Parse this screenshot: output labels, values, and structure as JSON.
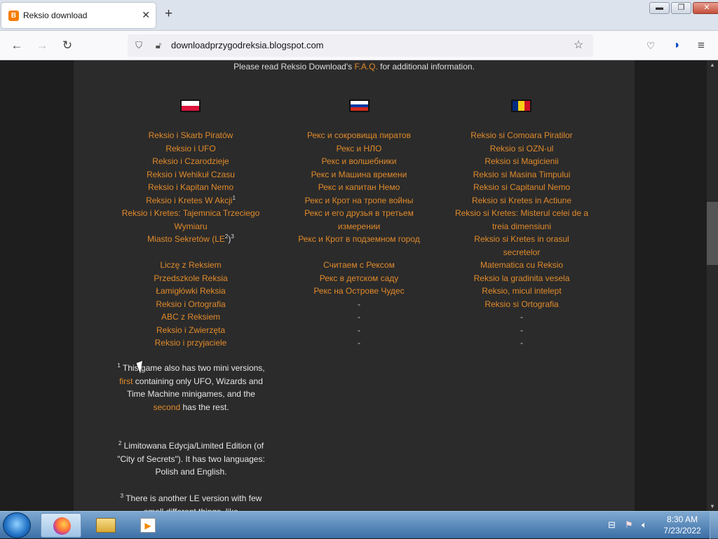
{
  "browser": {
    "tab_title": "Reksio download",
    "tab_favicon": "blogger-icon",
    "url": "downloadprzygodreksia.blogspot.com",
    "window_controls": [
      "minimize",
      "maximize",
      "close"
    ]
  },
  "page": {
    "notice_before": "Please read Reksio Download's ",
    "notice_link": "F.A.Q.",
    "notice_after": " for additional information.",
    "columns": [
      {
        "flag": "poland-flag",
        "flag_colors": [
          "#ffffff",
          "#dc143c"
        ],
        "items": [
          "Reksio i Skarb Piratów",
          "Reksio i UFO",
          "Reksio i Czarodzieje",
          "Reksio i Wehikuł Czasu",
          "Reksio i Kapitan Nemo",
          "Reksio i Kretes W Akcji",
          "Reksio i Kretes: Tajemnica Trzeciego Wymiaru",
          "Miasto Sekretów"
        ],
        "item6_sup": "1",
        "item8_suffix_open": " (",
        "item8_le": "LE",
        "item8_sup2": "2",
        "item8_close": ")",
        "item8_sup3": "3",
        "educational": [
          "Liczę z Reksiem",
          "Przedszkole Reksia",
          "Łamigłówki Reksia",
          "Reksio i Ortografia",
          "ABC z Reksiem",
          "Reksio i Zwierzęta",
          "Reksio i przyjaciele"
        ]
      },
      {
        "flag": "russia-flag",
        "flag_colors": [
          "#ffffff",
          "#0039a6",
          "#d52b1e"
        ],
        "items": [
          "Рекс и сокровища пиратов",
          "Рекс и НЛО",
          "Рекс и волшебники",
          "Рекс и Машина времени",
          "Рекс и капитан Немо",
          "Рекс и Крот на тропе войны",
          "Рекс и его друзья в третьем измерении",
          "Рекс и Крот в подземном город"
        ],
        "educational": [
          "Считаем с Рексом",
          "Рекс в детском саду",
          "Рекс на Острове Чудес",
          "-",
          "-",
          "-",
          "-"
        ]
      },
      {
        "flag": "romania-flag",
        "flag_colors": [
          "#002b7f",
          "#fcd116",
          "#ce1126"
        ],
        "items": [
          "Reksio si Comoara Piratilor",
          "Reksio si OZN-ul",
          "Reksio si Magicienii",
          "Reksio si Masina Timpului",
          "Reksio si Capitanul Nemo",
          "Reksio si Kretes in Actiune",
          "Reksio si Kretes: Misterul celei de a treia dimensiuni",
          "Reksio si Kretes in orasul secretelor"
        ],
        "educational": [
          "Matematica cu Reksio",
          "Reksio la gradinita vesela",
          "Reksio, micul intelept",
          "Reksio si Ortografia",
          "-",
          "-",
          "-"
        ]
      }
    ],
    "notes": {
      "n1_sup": "1",
      "n1_a": " This game also has two mini versions, ",
      "n1_first": "first",
      "n1_b": " containing only UFO, Wizards and Time Machine minigames, and the ",
      "n1_second": "second",
      "n1_c": " has the rest.",
      "n2_sup": "2",
      "n2_text": " Limitowana Edycja/Limited Edition (of \"City of Secrets\"). It has two languages: Polish and English.",
      "n3_sup": "3",
      "n3_text": " There is another LE version with few small different things, like"
    }
  },
  "taskbar": {
    "apps": [
      "windows-start-icon",
      "firefox-icon",
      "explorer-icon",
      "media-player-icon"
    ],
    "time": "8:30 AM",
    "date": "7/23/2022"
  }
}
